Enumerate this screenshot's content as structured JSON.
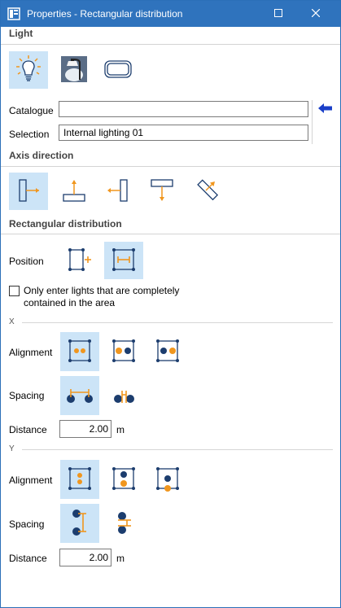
{
  "window": {
    "title": "Properties - Rectangular distribution",
    "accent": "#2f73bd"
  },
  "icons": {
    "app": "properties-icon",
    "maximize": "maximize-icon",
    "close": "close-icon",
    "back_arrow": "arrow-left-icon"
  },
  "light": {
    "heading": "Light",
    "types": [
      {
        "name": "bulb-light-icon",
        "selected": true
      },
      {
        "name": "wall-lamp-icon",
        "selected": false
      },
      {
        "name": "panel-light-icon",
        "selected": false
      }
    ],
    "catalogue_label": "Catalogue",
    "catalogue_value": "",
    "selection_label": "Selection",
    "selection_value": "Internal lighting 01"
  },
  "axis": {
    "heading": "Axis direction",
    "options": [
      "axis-right-icon",
      "axis-up-icon",
      "axis-left-icon",
      "axis-down-icon",
      "axis-diagonal-icon"
    ]
  },
  "distribution": {
    "heading": "Rectangular distribution",
    "position_label": "Position",
    "position_options": [
      "position-outside-icon",
      "position-inside-icon"
    ],
    "contained_checked": false,
    "contained_label": "Only enter lights that are completely contained in the area",
    "x": {
      "letter": "X",
      "alignment_label": "Alignment",
      "spacing_label": "Spacing",
      "distance_label": "Distance",
      "distance_value": "2.00",
      "unit": "m"
    },
    "y": {
      "letter": "Y",
      "alignment_label": "Alignment",
      "spacing_label": "Spacing",
      "distance_label": "Distance",
      "distance_value": "2.00",
      "unit": "m"
    }
  },
  "colors": {
    "selected_bg": "#cce4f7",
    "orange": "#f0961e",
    "navy": "#1c3d6e",
    "arrow_blue": "#1a3fc8"
  }
}
